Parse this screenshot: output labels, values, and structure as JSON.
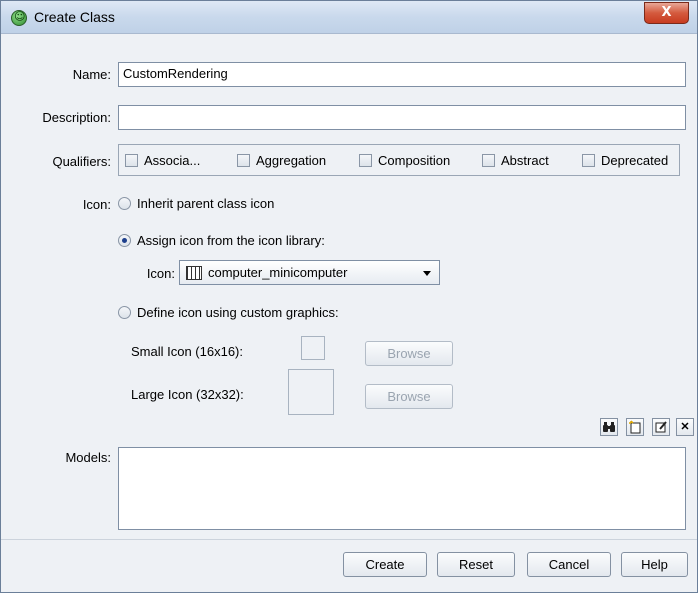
{
  "window": {
    "title": "Create Class",
    "close_label": "X"
  },
  "name": {
    "label": "Name:",
    "value": "CustomRendering"
  },
  "description": {
    "label": "Description:",
    "value": ""
  },
  "qualifiers": {
    "label": "Qualifiers:",
    "items": [
      {
        "label": "Associa...",
        "checked": false
      },
      {
        "label": "Aggregation",
        "checked": false
      },
      {
        "label": "Composition",
        "checked": false
      },
      {
        "label": "Abstract",
        "checked": false
      },
      {
        "label": "Deprecated",
        "checked": false
      }
    ]
  },
  "icon": {
    "label": "Icon:",
    "inherit_label": "Inherit parent class icon",
    "library_label": "Assign icon from the icon library:",
    "library_icon_label": "Icon:",
    "library_selected": "computer_minicomputer",
    "library_selected_icon": "grid-icon",
    "custom_label": "Define icon using custom graphics:",
    "small_label": "Small Icon (16x16):",
    "large_label": "Large Icon (32x32):",
    "browse_label": "Browse",
    "selected_option": "library"
  },
  "models": {
    "label": "Models:",
    "toolbar": [
      "binoculars-icon",
      "new-icon",
      "edit-icon",
      "delete-icon"
    ],
    "delete_glyph": "✕"
  },
  "buttons": {
    "create": "Create",
    "reset": "Reset",
    "cancel": "Cancel",
    "help": "Help"
  },
  "colors": {
    "titlebar": "#c9d9ec",
    "close": "#d45a3e",
    "background": "#eef1f5"
  }
}
